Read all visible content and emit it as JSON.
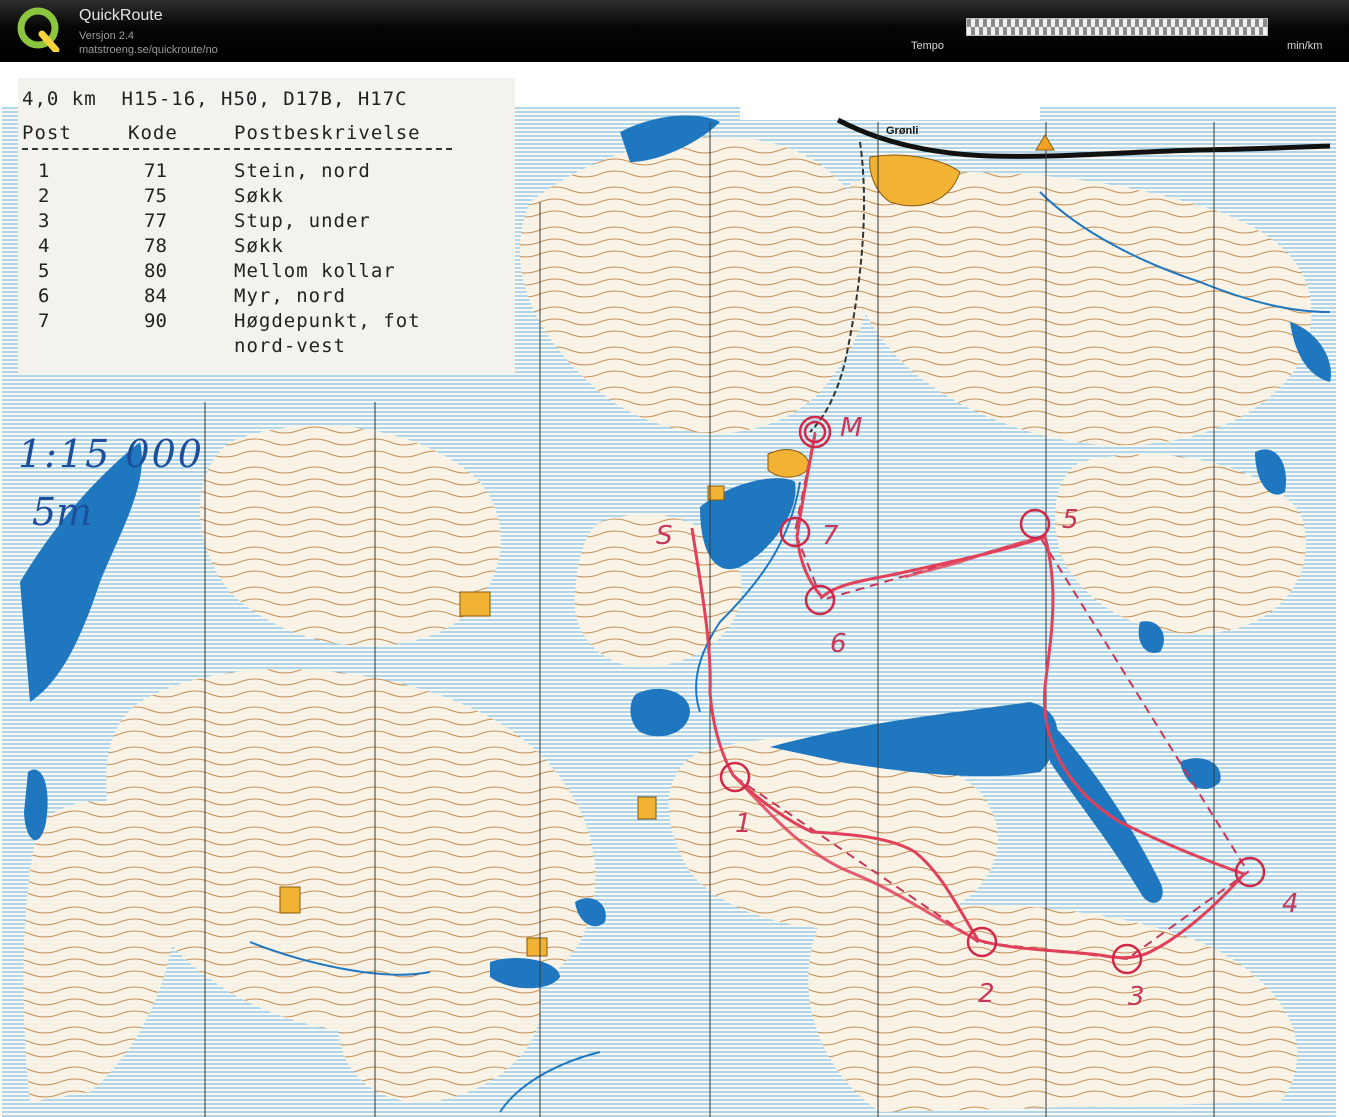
{
  "app": {
    "name": "QuickRoute",
    "version": "Versjon 2.4",
    "url": "matstroeng.se/quickroute/no"
  },
  "pace_legend": {
    "label": "Tempo",
    "unit": "min/km"
  },
  "course": {
    "header": "4,0 km  H15-16, H50, D17B, H17C",
    "columns": {
      "post": "Post",
      "code": "Kode",
      "description": "Postbeskrivelse"
    },
    "controls": [
      {
        "post": "1",
        "code": "71",
        "description": "Stein, nord"
      },
      {
        "post": "2",
        "code": "75",
        "description": "Søkk"
      },
      {
        "post": "3",
        "code": "77",
        "description": "Stup, under"
      },
      {
        "post": "4",
        "code": "78",
        "description": "Søkk"
      },
      {
        "post": "5",
        "code": "80",
        "description": "Mellom kollar"
      },
      {
        "post": "6",
        "code": "84",
        "description": "Myr, nord"
      },
      {
        "post": "7",
        "code": "90",
        "description": "Høgdepunkt, fot"
      },
      {
        "post": "",
        "code": "",
        "description": "nord-vest"
      }
    ]
  },
  "map": {
    "place_name": "Grønli",
    "scale_note": "1:15 000",
    "contour_note": "5m",
    "control_numbers": [
      "1",
      "2",
      "3",
      "4",
      "5",
      "6",
      "7"
    ],
    "finish_mark": "M",
    "start_mark": "S",
    "colors": {
      "water": "#1f78bf",
      "marsh": "#9fd0ea",
      "contour": "#b8783a",
      "route": "#e0405a",
      "course": "#c8365a",
      "settlement": "#f2b233",
      "paper": "#fbf7ef"
    }
  },
  "icons": [
    "quickroute-logo-icon",
    "start-triangle-icon"
  ]
}
